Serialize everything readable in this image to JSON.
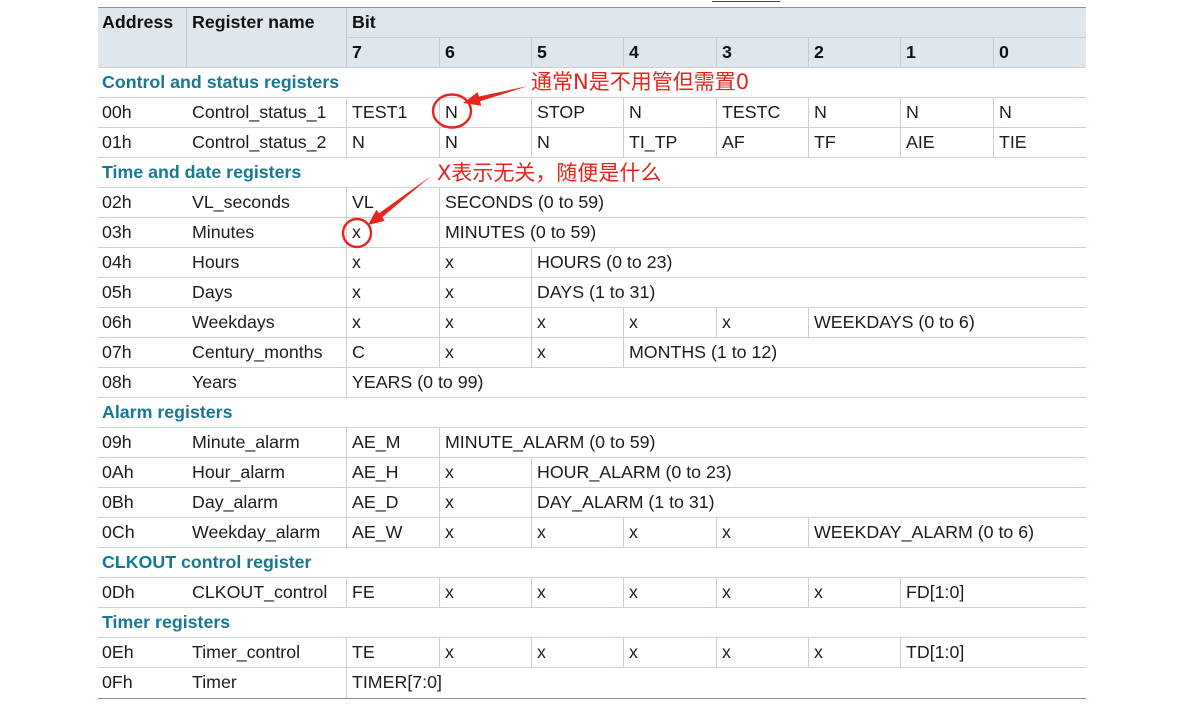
{
  "colors": {
    "section_title": "#167891",
    "header_background": "#dfe7ed",
    "annotation": "#e8251c"
  },
  "table": {
    "header": {
      "address": "Address",
      "register_name": "Register name",
      "bit": "Bit",
      "bits": [
        "7",
        "6",
        "5",
        "4",
        "3",
        "2",
        "1",
        "0"
      ]
    },
    "sections": [
      {
        "title": "Control and status registers",
        "rows": [
          {
            "address": "00h",
            "name": "Control_status_1",
            "cells": [
              "TEST1",
              "N",
              "STOP",
              "N",
              "TESTC",
              "N",
              "N",
              "N"
            ]
          },
          {
            "address": "01h",
            "name": "Control_status_2",
            "cells": [
              "N",
              "N",
              "N",
              "TI_TP",
              "AF",
              "TF",
              "AIE",
              "TIE"
            ]
          }
        ]
      },
      {
        "title": "Time and date registers",
        "rows": [
          {
            "address": "02h",
            "name": "VL_seconds",
            "cells": [
              "VL",
              {
                "text": "SECONDS (0 to 59)",
                "span": 7
              }
            ]
          },
          {
            "address": "03h",
            "name": "Minutes",
            "cells": [
              "x",
              {
                "text": "MINUTES (0 to 59)",
                "span": 7
              }
            ]
          },
          {
            "address": "04h",
            "name": "Hours",
            "cells": [
              "x",
              "x",
              {
                "text": "HOURS (0 to 23)",
                "span": 6
              }
            ]
          },
          {
            "address": "05h",
            "name": "Days",
            "cells": [
              "x",
              "x",
              {
                "text": "DAYS (1 to 31)",
                "span": 6
              }
            ]
          },
          {
            "address": "06h",
            "name": "Weekdays",
            "cells": [
              "x",
              "x",
              "x",
              "x",
              "x",
              {
                "text": "WEEKDAYS (0 to 6)",
                "span": 3
              }
            ]
          },
          {
            "address": "07h",
            "name": "Century_months",
            "cells": [
              "C",
              "x",
              "x",
              {
                "text": "MONTHS (1 to 12)",
                "span": 5
              }
            ]
          },
          {
            "address": "08h",
            "name": "Years",
            "cells": [
              {
                "text": "YEARS (0 to 99)",
                "span": 8
              }
            ]
          }
        ]
      },
      {
        "title": "Alarm registers",
        "rows": [
          {
            "address": "09h",
            "name": "Minute_alarm",
            "cells": [
              "AE_M",
              {
                "text": "MINUTE_ALARM (0 to 59)",
                "span": 7
              }
            ]
          },
          {
            "address": "0Ah",
            "name": "Hour_alarm",
            "cells": [
              "AE_H",
              "x",
              {
                "text": "HOUR_ALARM (0 to 23)",
                "span": 6
              }
            ]
          },
          {
            "address": "0Bh",
            "name": "Day_alarm",
            "cells": [
              "AE_D",
              "x",
              {
                "text": "DAY_ALARM (1 to 31)",
                "span": 6
              }
            ]
          },
          {
            "address": "0Ch",
            "name": "Weekday_alarm",
            "cells": [
              "AE_W",
              "x",
              "x",
              "x",
              "x",
              {
                "text": "WEEKDAY_ALARM (0 to 6)",
                "span": 3
              }
            ]
          }
        ]
      },
      {
        "title": "CLKOUT control register",
        "rows": [
          {
            "address": "0Dh",
            "name": "CLKOUT_control",
            "cells": [
              "FE",
              "x",
              "x",
              "x",
              "x",
              "x",
              {
                "text": "FD[1:0]",
                "span": 2
              }
            ]
          }
        ]
      },
      {
        "title": "Timer registers",
        "rows": [
          {
            "address": "0Eh",
            "name": "Timer_control",
            "cells": [
              "TE",
              "x",
              "x",
              "x",
              "x",
              "x",
              {
                "text": "TD[1:0]",
                "span": 2
              }
            ]
          },
          {
            "address": "0Fh",
            "name": "Timer",
            "cells": [
              {
                "text": "TIMER[7:0]",
                "span": 8
              }
            ]
          }
        ]
      }
    ]
  },
  "annotations": {
    "note_n": "通常N是不用管但需置0",
    "note_x": "X表示无关，随便是什么"
  }
}
